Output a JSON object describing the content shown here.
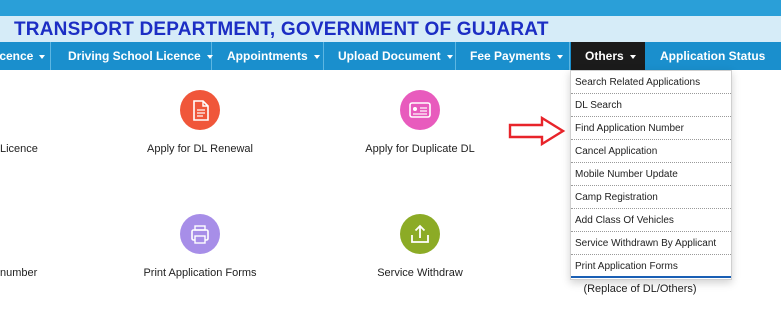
{
  "header": {
    "title": "TRANSPORT DEPARTMENT, GOVERNMENT OF GUJARAT"
  },
  "nav": {
    "items": [
      {
        "label": "icence"
      },
      {
        "label": "Driving School Licence"
      },
      {
        "label": "Appointments"
      },
      {
        "label": "Upload Document"
      },
      {
        "label": "Fee Payments"
      },
      {
        "label": "Others"
      },
      {
        "label": "Application Status"
      }
    ]
  },
  "tiles": {
    "row1_left_partial": "Licence",
    "dl_renewal": "Apply for DL Renewal",
    "duplicate_dl": "Apply for Duplicate DL",
    "row2_left_partial": "number",
    "print_forms": "Print Application Forms",
    "service_withdraw": "Service Withdraw",
    "replace_dl_others": "(Replace of DL/Others)"
  },
  "others_menu": {
    "items": [
      "Search Related Applications",
      "DL Search",
      "Find Application Number",
      "Cancel Application",
      "Mobile Number Update",
      "Camp Registration",
      "Add Class Of Vehicles",
      "Service Withdrawn By Applicant",
      "Print Application Forms"
    ]
  },
  "icons": {
    "dl_renewal": "document-icon",
    "duplicate_dl": "id-card-icon",
    "print_forms": "print-icon",
    "service_withdraw": "upload-tray-icon",
    "pointer": "red-arrow-icon"
  },
  "colors": {
    "top_strip": "#2a9fd8",
    "banner": "#d6ecf8",
    "title": "#1c2ec4",
    "navbar": "#1a8fcd",
    "active_nav": "#1b1b1b",
    "renewal_icon": "#f0563a",
    "duplicate_icon": "#e85bbd",
    "print_icon": "#a78ee8",
    "withdraw_icon": "#8cab26",
    "arrow": "#e8242a"
  }
}
